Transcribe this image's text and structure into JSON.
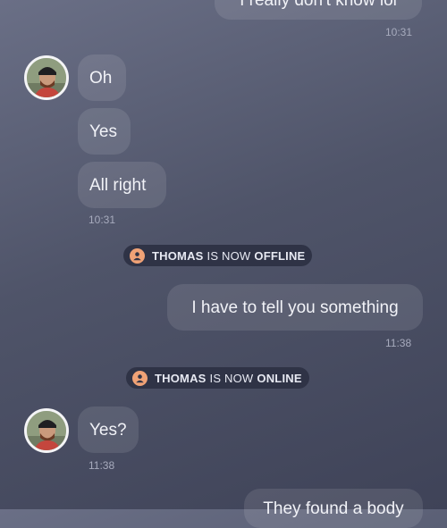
{
  "messages": {
    "top_partial": "I really don't know lol",
    "top_time": "10:31",
    "in_1": "Oh",
    "in_2": "Yes",
    "in_3": "All right",
    "in_group1_time": "10:31",
    "out_1": "I have to tell you something",
    "out_1_time": "11:38",
    "in_4": "Yes?",
    "in_4_time": "11:38",
    "bottom_partial": "They found a body"
  },
  "status": {
    "offline": {
      "name": "THOMAS",
      "middle": "IS NOW",
      "state": "OFFLINE"
    },
    "online": {
      "name": "THOMAS",
      "middle": "IS NOW",
      "state": "ONLINE"
    }
  },
  "colors": {
    "status_icon": "#f0a276",
    "bubble": "rgba(255,255,255,0.10)"
  },
  "icons": [
    "user-icon",
    "avatar"
  ]
}
